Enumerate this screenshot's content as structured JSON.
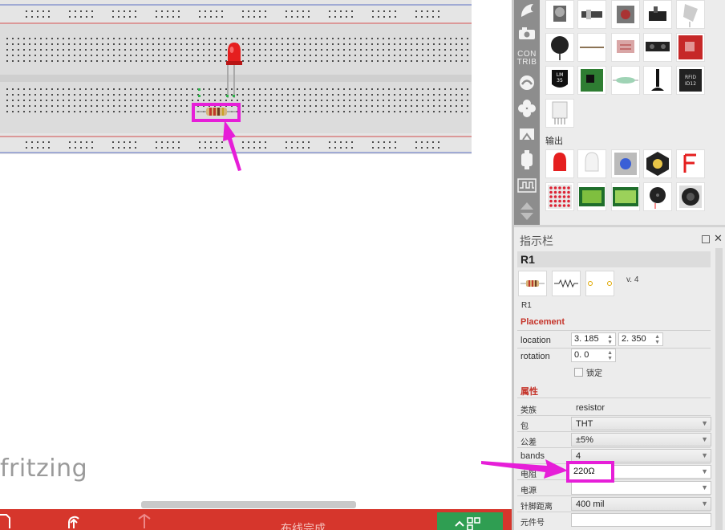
{
  "canvas": {
    "logo_text": "fritzing",
    "status_text": "布线完成"
  },
  "parts_bin": {
    "tabs": [
      {
        "name": "core-parts-icon"
      },
      {
        "name": "mine-parts-icon"
      },
      {
        "name": "contrib-tab",
        "label_line1": "CON",
        "label_line2": "TRIB"
      },
      {
        "name": "seeed-parts-icon"
      },
      {
        "name": "flower-parts-icon"
      },
      {
        "name": "chip-parts-icon"
      },
      {
        "name": "arduino-parts-icon"
      },
      {
        "name": "signal-parts-icon"
      },
      {
        "name": "arrows-parts-icon"
      }
    ],
    "section_output_label": "输出",
    "lm35_label": "LM\n35",
    "rfid_label": "RFID\nID12"
  },
  "inspector": {
    "title": "指示栏",
    "part_title": "R1",
    "version": "v. 4",
    "part_label": "R1",
    "placement_heading": "Placement",
    "location_label": "location",
    "location_x": "3. 185",
    "location_y": "2. 350",
    "rotation_label": "rotation",
    "rotation_value": "0. 0",
    "lock_label": "锁定",
    "properties_heading": "属性",
    "family_label": "类族",
    "family_value": "resistor",
    "package_label": "包",
    "package_value": "THT",
    "tolerance_label": "公差",
    "tolerance_value": "±5%",
    "bands_label": "bands",
    "bands_value": "4",
    "resistance_label": "电阻",
    "resistance_value": "220Ω",
    "power_label": "电源",
    "power_value": "",
    "pin_spacing_label": "针脚距离",
    "pin_spacing_value": "400 mil",
    "part_number_label": "元件号",
    "part_number_value": ""
  },
  "colors": {
    "accent_red": "#d6362c",
    "highlight_magenta": "#e61ed8",
    "go_green": "#2f9e52",
    "bin_tab_gray": "#8d8d8d"
  }
}
